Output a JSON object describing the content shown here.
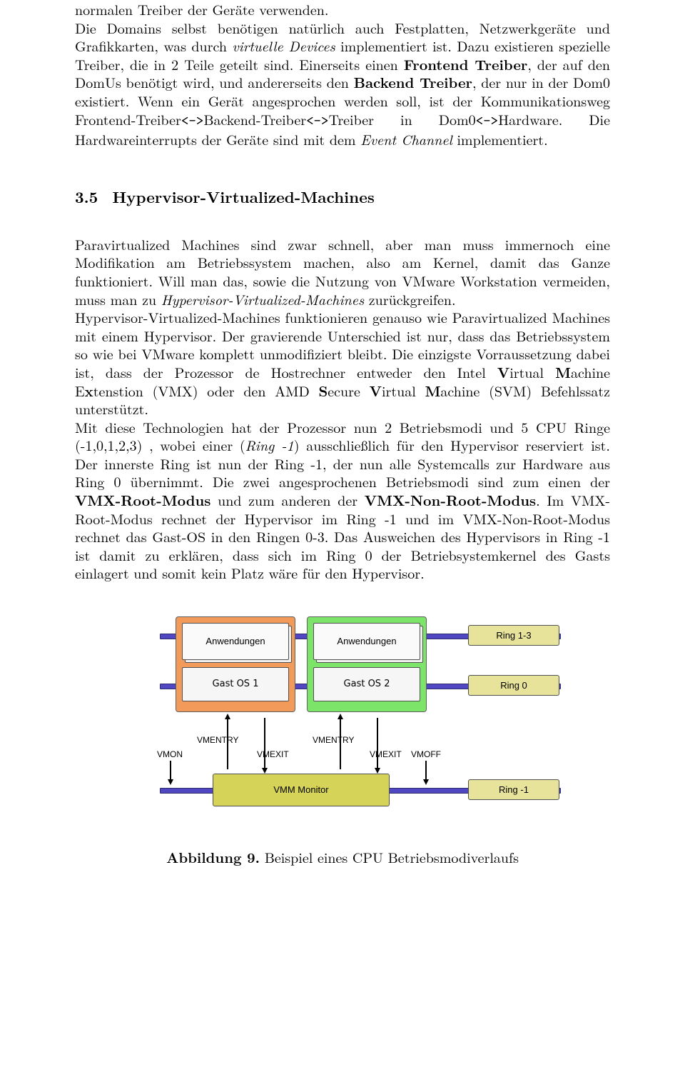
{
  "p1_a": "normalen Treiber der Geräte verwenden.",
  "p1_b": "Die Domains selbst benötigen natürlich auch Festplatten, Netzwerkgeräte und Grafikkarten, was durch ",
  "p1_c": "virtuelle Devices",
  "p1_d": " implementiert ist. Dazu existieren spezielle Treiber, die in 2 Teile geteilt sind. Einerseits einen ",
  "p1_e": "Frontend Treiber",
  "p1_f": ", der auf den DomUs benötigt wird, und andererseits den ",
  "p1_g": "Backend Treiber",
  "p1_h": ", der nur in der Dom0 existiert. Wenn ein Gerät angesprochen werden soll, ist der Kommunikationsweg Frontend-Treiber",
  "arrow": "<->",
  "p1_i": "Backend-Treiber",
  "p1_j": "Treiber in Dom0",
  "p1_k": "Hardware. Die Hardwareinterrupts der Geräte sind mit dem ",
  "p1_l": "Event Channel",
  "p1_m": " implementiert.",
  "sec_num": "3.5",
  "sec_title": "Hypervisor-Virtualized-Machines",
  "p2_a": "Paravirtualized Machines sind zwar schnell, aber man muss immernoch eine Modifikation am Betriebssystem machen, also am Kernel, damit das Ganze funktioniert. Will man das, sowie die Nutzung von VMware Workstation vermeiden, muss man zu ",
  "p2_b": "Hypervisor-Virtualized-Machines",
  "p2_c": " zurückgreifen.",
  "p2_d": "Hypervisor-Virtualized-Machines funktionieren genauso wie Paravirtualized Machines mit einem Hypervisor. Der gravierende Unterschied ist nur, dass das Betriebssystem so wie bei VMware komplett unmodifiziert bleibt. Die einzigste Vorraussetzung dabei ist, dass der Prozessor de Hostrechner entweder den Intel ",
  "p2_e": "V",
  "p2_f": "irtual ",
  "p2_g": "M",
  "p2_h": "achine E",
  "p2_i": "x",
  "p2_j": "tenstion (VMX) oder den AMD ",
  "p2_k": "S",
  "p2_l": "ecure ",
  "p2_m": "V",
  "p2_n": "irtual ",
  "p2_o": "M",
  "p2_p": "achine (SVM) Befehlssatz unterstützt.",
  "p2_q": "Mit diese Technologien hat der Prozessor nun 2 Betriebsmodi und 5 CPU Ringe (-1,0,1,2,3) , wobei einer (",
  "p2_r": "Ring -1",
  "p2_s": ") ausschließlich für den Hypervisor reserviert ist. Der innerste Ring ist nun der Ring -1, der nun alle Systemcalls zur Hardware aus Ring 0 übernimmt. Die zwei angesprochenen Betriebsmodi sind zum einen der ",
  "p2_t": "VMX-Root-Modus",
  "p2_u": " und zum anderen der ",
  "p2_v": "VMX-Non-Root-Modus",
  "p2_w": ". Im VMX-Root-Modus rechnet der Hypervisor im Ring -1 und im VMX-Non-Root-Modus rechnet das Gast-OS in den Ringen 0-3. Das Ausweichen des Hypervisors in Ring -1 ist damit zu erklären, dass sich im Ring 0 der Betriebsystemkernel des Gasts einlagert und somit kein Platz wäre für den Hypervisor.",
  "fig_label": "Abbildung 9.",
  "fig_caption": " Beispiel eines CPU Betriebsmodiverlaufs",
  "fig": {
    "anw": "Anwendungen",
    "gast1": "Gast OS 1",
    "gast2": "Gast OS 2",
    "ring13": "Ring 1-3",
    "ring0": "Ring 0",
    "ringm1": "Ring -1",
    "vmm": "VMM Monitor",
    "vmon": "VMON",
    "vmoff": "VMOFF",
    "vmentry": "VMENTRY",
    "vmexit": "VMEXIT"
  }
}
